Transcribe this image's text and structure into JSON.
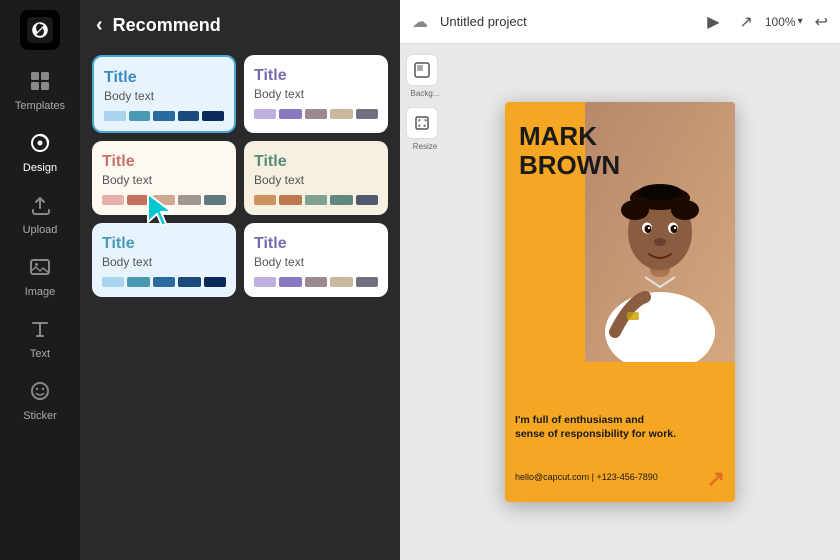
{
  "app": {
    "logo_symbol": "✂",
    "project_name": "Untitled project",
    "zoom": "100%"
  },
  "sidebar": {
    "items": [
      {
        "id": "templates",
        "icon": "⊞",
        "label": "Templates"
      },
      {
        "id": "design",
        "icon": "🎨",
        "label": "Design",
        "active": true
      },
      {
        "id": "upload",
        "icon": "⬆",
        "label": "Upload"
      },
      {
        "id": "image",
        "icon": "🖼",
        "label": "Image"
      },
      {
        "id": "text",
        "icon": "T",
        "label": "Text"
      },
      {
        "id": "sticker",
        "icon": "⏰",
        "label": "Sticker"
      }
    ]
  },
  "panel": {
    "back_label": "‹",
    "title": "Recommend",
    "cards": [
      {
        "id": "card1",
        "title": "Title",
        "body": "Body text",
        "title_color": "#3b8ac4",
        "swatches": [
          "#a8d4f0",
          "#4a9ab4",
          "#2a6a9c",
          "#1a4a7c",
          "#0a2a5c"
        ],
        "selected": true,
        "bg": "#e8f4fd"
      },
      {
        "id": "card2",
        "title": "Title",
        "body": "Body text",
        "title_color": "#7b6ab0",
        "swatches": [
          "#c0b0e0",
          "#8a78c0",
          "#9a8890",
          "#c8b8a0",
          "#707080"
        ],
        "selected": false,
        "bg": "#fff"
      },
      {
        "id": "card3",
        "title": "Title",
        "body": "Body text",
        "title_color": "#c4746a",
        "swatches": [
          "#e8b0a8",
          "#c87060",
          "#d0a890",
          "#a09890",
          "#607880"
        ],
        "selected": false,
        "bg": "#fdf8f0"
      },
      {
        "id": "card4",
        "title": "Title",
        "body": "Body text",
        "title_color": "#5a8a7a",
        "swatches": [
          "#d09060",
          "#c07850",
          "#80a090",
          "#608880",
          "#505870"
        ],
        "selected": false,
        "bg": "#f5f0e0"
      },
      {
        "id": "card5",
        "title": "Title",
        "body": "Body text",
        "title_color": "#4a9ab4",
        "swatches": [
          "#a8d4f0",
          "#4a9ab4",
          "#2a6a9c",
          "#1a4a7c",
          "#0a2a5c"
        ],
        "selected": false,
        "bg": "#e8f4fd"
      },
      {
        "id": "card6",
        "title": "Title",
        "body": "Body text",
        "title_color": "#7b6ab0",
        "swatches": [
          "#c0b0e0",
          "#8a78c0",
          "#9a8890",
          "#c8b8a0",
          "#707080"
        ],
        "selected": false,
        "bg": "#fff"
      }
    ]
  },
  "canvas": {
    "person_name_line1": "MARK",
    "person_name_line2": "BROWN",
    "tagline": "I'm full of enthusiasm and\nsense of responsibility for work.",
    "contact": "hello@capcut.com | +123-456-7890"
  },
  "toolbar": {
    "project_name": "Untitled project",
    "zoom_label": "100%",
    "background_label": "Backg...",
    "resize_label": "Resize"
  }
}
